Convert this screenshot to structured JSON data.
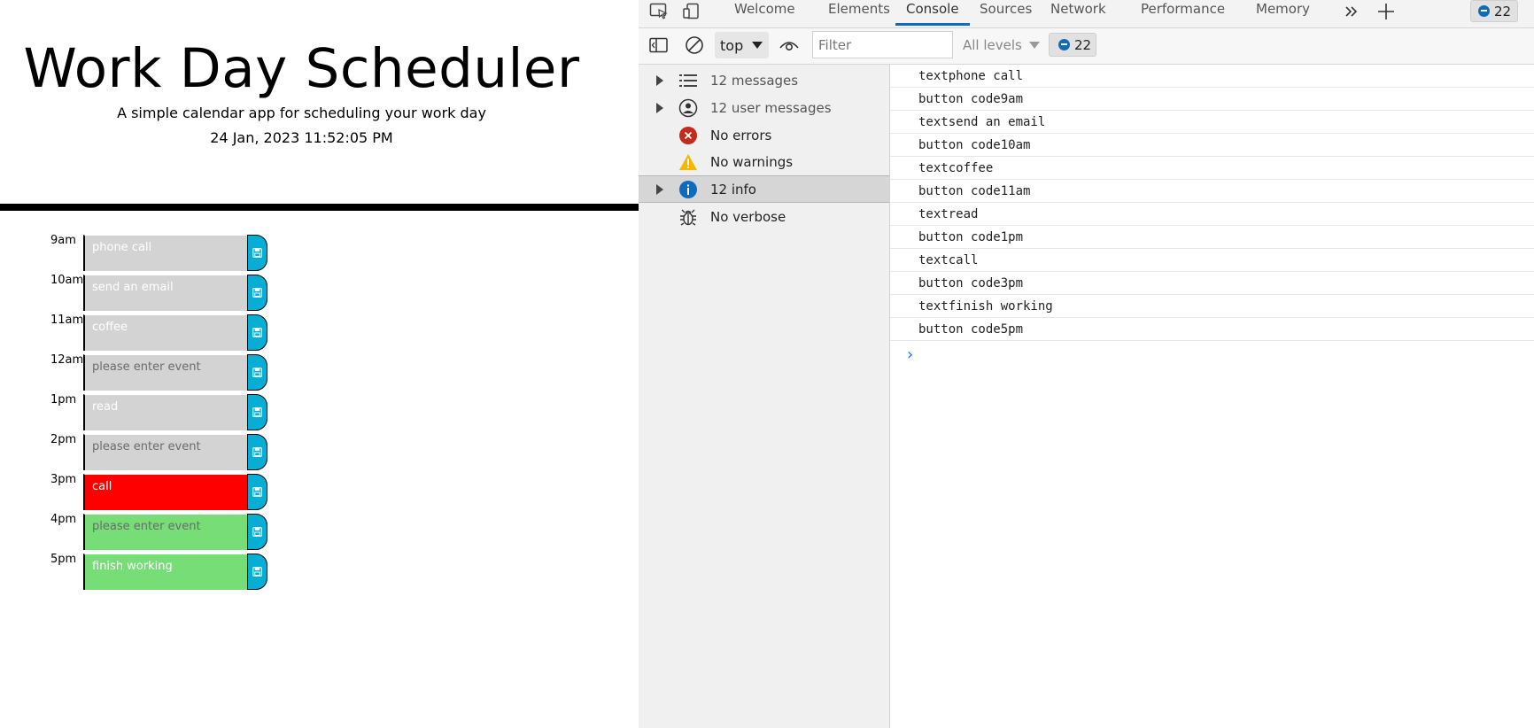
{
  "scheduler": {
    "title": "Work Day Scheduler",
    "lead": "A simple calendar app for scheduling your work day",
    "current_date": "24 Jan, 2023 11:52:05 PM",
    "placeholder": "please enter event",
    "rows": [
      {
        "hour": "9am",
        "text": "phone call",
        "state": "past"
      },
      {
        "hour": "10am",
        "text": "send an email",
        "state": "past"
      },
      {
        "hour": "11am",
        "text": "coffee",
        "state": "past"
      },
      {
        "hour": "12am",
        "text": "",
        "state": "past"
      },
      {
        "hour": "1pm",
        "text": "read",
        "state": "past"
      },
      {
        "hour": "2pm",
        "text": "",
        "state": "past"
      },
      {
        "hour": "3pm",
        "text": "call",
        "state": "present"
      },
      {
        "hour": "4pm",
        "text": "",
        "state": "future"
      },
      {
        "hour": "5pm",
        "text": "finish working",
        "state": "future"
      }
    ],
    "colors": {
      "past": "#d3d3d3",
      "present": "#ff0000",
      "future": "#77dd77",
      "save": "#06aed5"
    }
  },
  "devtools": {
    "tabs": [
      "Welcome",
      "Elements",
      "Console",
      "Sources",
      "Network",
      "Performance",
      "Memory"
    ],
    "active_tab": "Console",
    "issues_count": "22",
    "toolbar": {
      "context": "top",
      "filter_placeholder": "Filter",
      "levels": "All levels",
      "badge_count": "22"
    },
    "sidebar": [
      {
        "label": "12 messages",
        "icon": "list-icon",
        "expandable": true
      },
      {
        "label": "12 user messages",
        "icon": "user-icon",
        "expandable": true
      },
      {
        "label": "No errors",
        "icon": "error-icon",
        "expandable": false
      },
      {
        "label": "No warnings",
        "icon": "warning-icon",
        "expandable": false
      },
      {
        "label": "12 info",
        "icon": "info-icon",
        "expandable": true,
        "selected": true
      },
      {
        "label": "No verbose",
        "icon": "bug-icon",
        "expandable": false
      }
    ],
    "console_lines": [
      "textphone call",
      "button code9am",
      "textsend an email",
      "button code10am",
      "textcoffee",
      "button code11am",
      "textread",
      "button code1pm",
      "textcall",
      "button code3pm",
      "textfinish working",
      "button code5pm"
    ],
    "prompt": "›"
  }
}
